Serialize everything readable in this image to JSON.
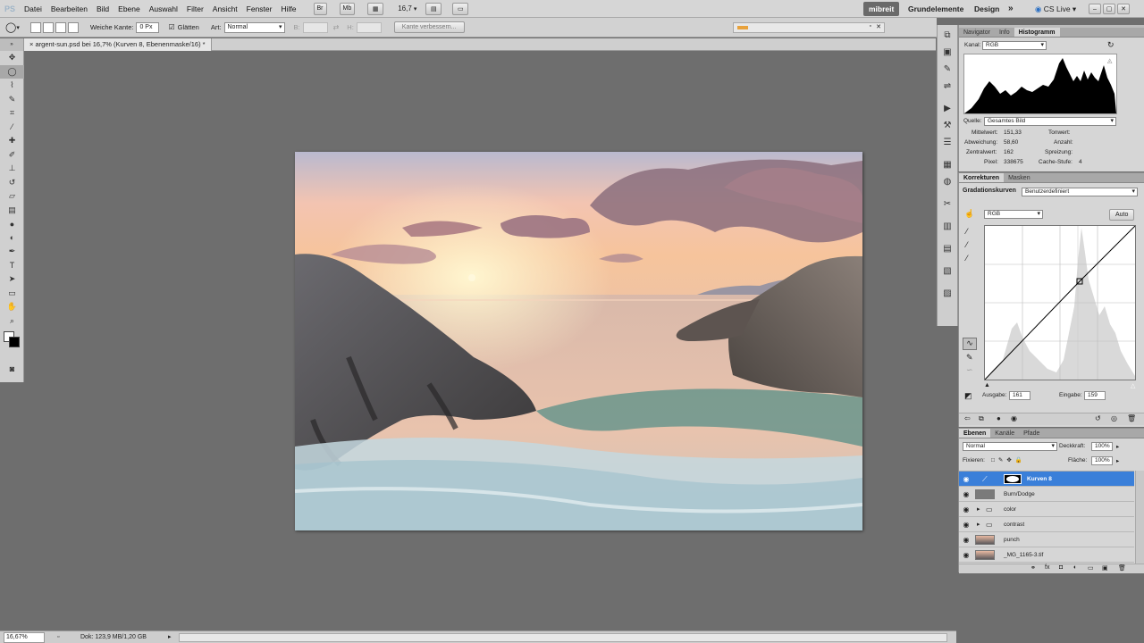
{
  "app": {
    "logo": "PS"
  },
  "menu": [
    "Datei",
    "Bearbeiten",
    "Bild",
    "Ebene",
    "Auswahl",
    "Filter",
    "Ansicht",
    "Fenster",
    "Hilfe"
  ],
  "menubar": {
    "bridge": "Br",
    "minibridge": "Mb",
    "zoom": "16,7",
    "more": "»",
    "workspaces": {
      "active": "mibreit",
      "items": [
        "Grundelemente",
        "Design"
      ],
      "more": "»"
    },
    "cslive": "CS Live",
    "window_controls": [
      "–",
      "▢",
      "✕"
    ]
  },
  "options": {
    "feather_label": "Weiche Kante:",
    "feather_value": "0 Px",
    "antialias_label": "Glätten",
    "antialias_checked": true,
    "style_label": "Art:",
    "style_value": "Normal",
    "width_label": "B:",
    "height_label": "H:",
    "refine_label": "Kante verbessern..."
  },
  "document": {
    "tab_title": "argent-sun.psd bei 16,7% (Kurven 8, Ebenenmaske/16) *"
  },
  "status": {
    "zoom": "16,67%",
    "doc": "Dok: 123,9 MB/1,20 GB"
  },
  "toolbox": [
    "move",
    "marquee-ellipse",
    "lasso",
    "quick-select",
    "crop",
    "eyedropper",
    "healing",
    "brush",
    "stamp",
    "history-brush",
    "eraser",
    "gradient",
    "blur",
    "dodge",
    "pen",
    "type",
    "path-select",
    "shape",
    "hand",
    "zoom"
  ],
  "navigator": {
    "tabs": [
      "Navigator",
      "Info",
      "Histogramm"
    ],
    "active_tab": "Histogramm",
    "channel_label": "Kanal:",
    "channel_value": "RGB",
    "source_label": "Quelle:",
    "source_value": "Gesamtes Bild",
    "stats_left": [
      {
        "label": "Mittelwert:",
        "value": "151,33"
      },
      {
        "label": "Abweichung:",
        "value": "58,60"
      },
      {
        "label": "Zentralwert:",
        "value": "162"
      },
      {
        "label": "Pixel:",
        "value": "338675"
      }
    ],
    "stats_right": [
      {
        "label": "Tonwert:",
        "value": ""
      },
      {
        "label": "Anzahl:",
        "value": ""
      },
      {
        "label": "Spreizung:",
        "value": ""
      },
      {
        "label": "Cache-Stufe:",
        "value": "4"
      }
    ]
  },
  "adjustments": {
    "tabs": [
      "Korrekturen",
      "Masken"
    ],
    "active_tab": "Korrekturen",
    "title": "Gradationskurven",
    "preset": "Benutzerdefiniert",
    "channel": "RGB",
    "auto_label": "Auto",
    "output_label": "Ausgabe:",
    "output_value": "161",
    "input_label": "Eingabe:",
    "input_value": "159"
  },
  "layers": {
    "tabs": [
      "Ebenen",
      "Kanäle",
      "Pfade"
    ],
    "active_tab": "Ebenen",
    "blend_mode": "Normal",
    "opacity_label": "Deckkraft:",
    "opacity_value": "100%",
    "lock_label": "Fixieren:",
    "fill_label": "Fläche:",
    "fill_value": "100%",
    "items": [
      {
        "name": "Kurven 8",
        "selected": true,
        "type": "adjustment"
      },
      {
        "name": "Burn/Dodge",
        "selected": false,
        "type": "gray"
      },
      {
        "name": "color",
        "selected": false,
        "type": "group"
      },
      {
        "name": "contrast",
        "selected": false,
        "type": "group"
      },
      {
        "name": "punch",
        "selected": false,
        "type": "image"
      },
      {
        "name": "_MG_1165-3.tif",
        "selected": false,
        "type": "image"
      }
    ]
  },
  "colors": {
    "ui_bg": "#d6d6d6",
    "canvas_bg": "#6e6e6e",
    "selection": "#3a7fd9",
    "mibreit_active": "#6a6a6a"
  }
}
